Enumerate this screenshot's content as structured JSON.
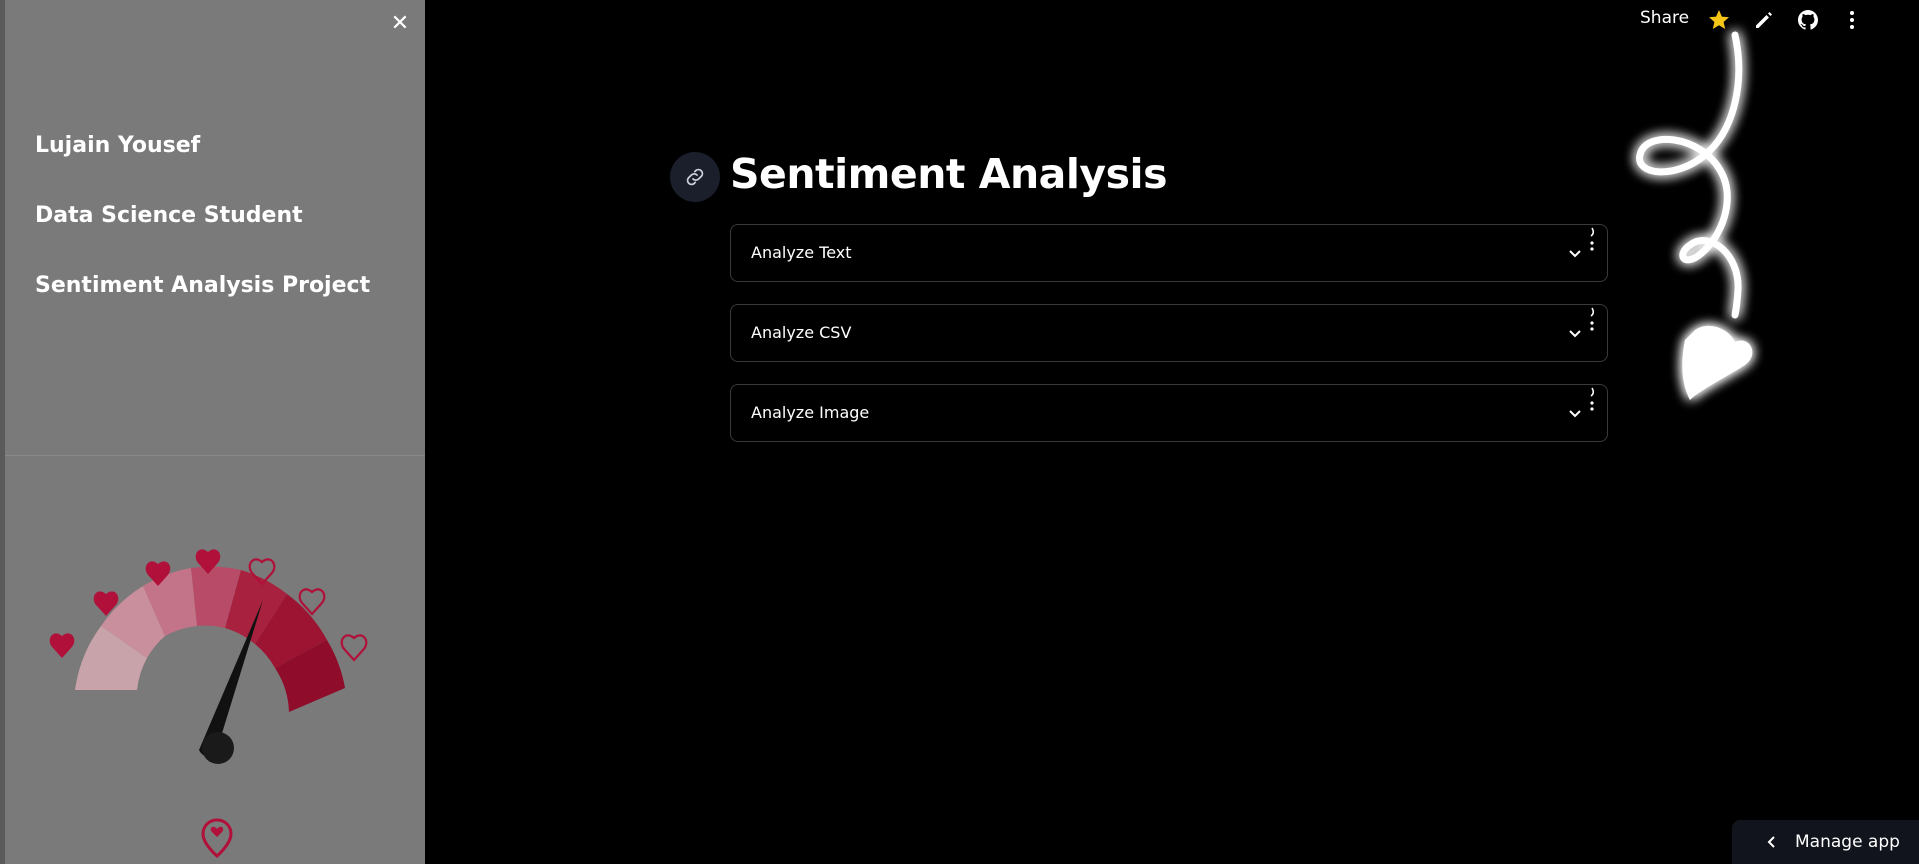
{
  "sidebar": {
    "close_icon": "close-icon",
    "items": [
      {
        "label": "Lujain Yousef"
      },
      {
        "label": "Data Science Student"
      },
      {
        "label": "Sentiment Analysis Project"
      }
    ],
    "gauge_image": "heart-meter-gauge",
    "pin_icon": "heart-location-pin-icon"
  },
  "toolbar": {
    "share_label": "Share",
    "icons": [
      "star-icon",
      "pencil-icon",
      "github-icon",
      "more-vertical-icon"
    ],
    "star_color": "#f5c518"
  },
  "main": {
    "link_icon": "link-icon",
    "title": "Sentiment Analysis",
    "expanders": [
      {
        "label": "Analyze Text"
      },
      {
        "label": "Analyze CSV"
      },
      {
        "label": "Analyze Image"
      }
    ]
  },
  "manage_app": {
    "label": "Manage app",
    "icon": "chevron-left-icon"
  },
  "colors": {
    "sidebar_bg": "#7a7a7a",
    "main_bg": "#000000",
    "accent_heart": "#b0103a",
    "link_button_bg": "#1a1f2b"
  }
}
